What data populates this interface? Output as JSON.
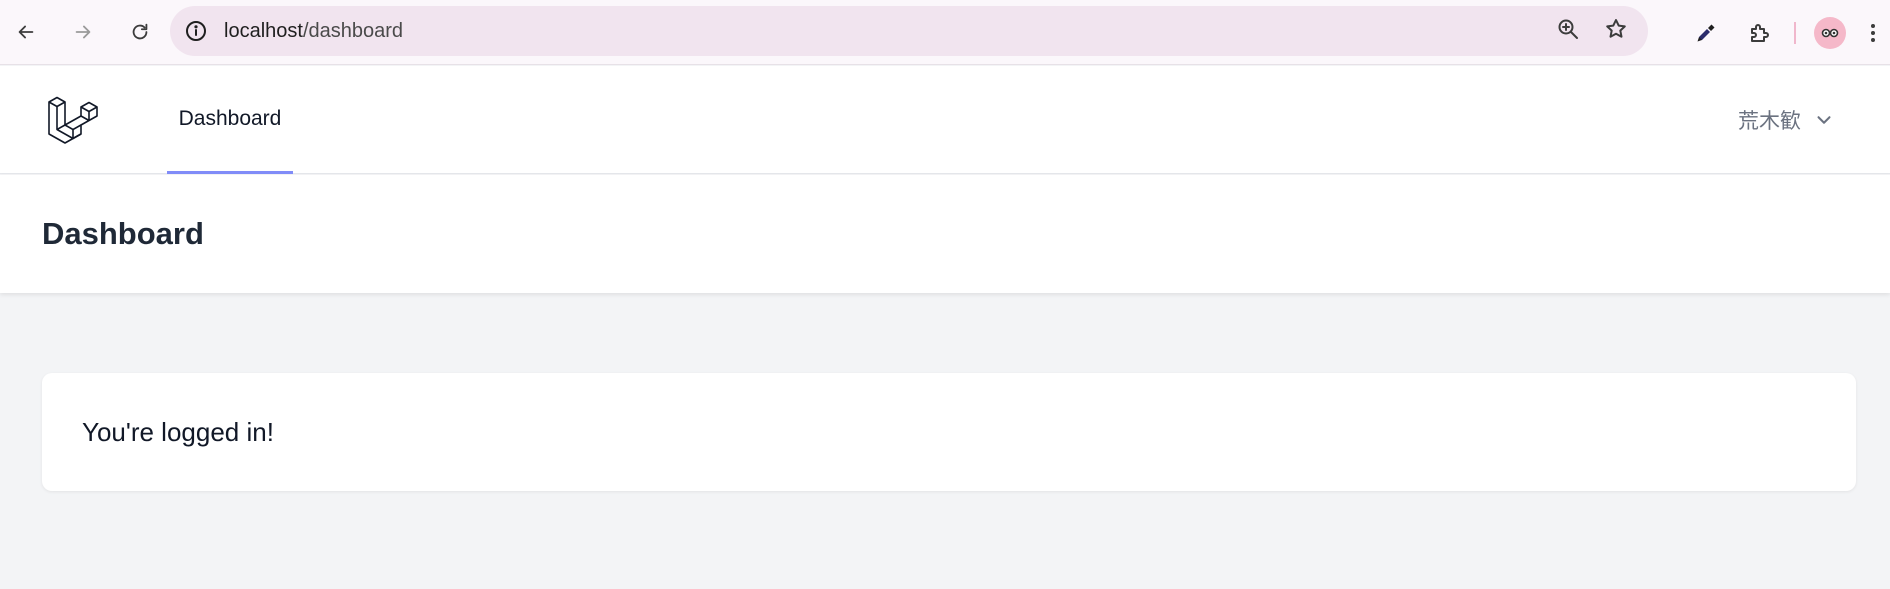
{
  "browser": {
    "url_host": "localhost",
    "url_path": "/dashboard",
    "back_icon": "arrow-left-icon",
    "forward_icon": "arrow-right-icon",
    "reload_icon": "reload-icon",
    "site_info_icon": "info-icon",
    "zoom_icon": "zoom-in-icon",
    "bookmark_icon": "star-icon",
    "eyedropper_icon": "eyedropper-icon",
    "extensions_icon": "puzzle-icon",
    "profile_icon": "avatar-icon",
    "menu_icon": "kebab-menu-icon"
  },
  "nav": {
    "logo": "laravel-logo",
    "links": [
      {
        "label": "Dashboard",
        "active": true
      }
    ],
    "user_name": "荒木歓",
    "accent_color": "#818cf8"
  },
  "header": {
    "title": "Dashboard"
  },
  "card": {
    "message": "You're logged in!"
  }
}
